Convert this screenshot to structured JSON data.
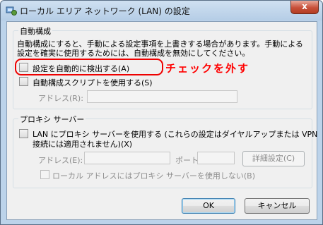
{
  "window": {
    "title": "ローカル エリア ネットワーク (LAN) の設定",
    "close_label": "x"
  },
  "auto_config": {
    "group_title": "自動構成",
    "description_line1": "自動構成にすると、手動による設定事項を上書きする場合があります。手動による",
    "description_line2": "設定を確実に使用するためには、自動構成を無効にしてください。",
    "auto_detect_label": "設定を自動的に検出する(A)",
    "auto_detect_checked": false,
    "script_label": "自動構成スクリプトを使用する(S)",
    "script_checked": false,
    "address_label": "アドレス(R):",
    "address_value": ""
  },
  "proxy": {
    "group_title": "プロキシ サーバー",
    "use_proxy_line1": "LAN にプロキシ サーバーを使用する (これらの設定はダイヤルアップまたは VPN",
    "use_proxy_line2": "接続には適用されません)(X)",
    "use_proxy_checked": false,
    "address_label": "アドレス(E):",
    "address_value": "",
    "port_label": "ポート(T):",
    "port_value": "",
    "advanced_label": "詳細設定(C)",
    "bypass_local_label": "ローカル アドレスにはプロキシ サーバーを使用しない(B)",
    "bypass_local_checked": false
  },
  "buttons": {
    "ok_label": "OK",
    "cancel_label": "キャンセル"
  },
  "annotation": {
    "text": "チェックを外す",
    "color": "#ff0000"
  }
}
